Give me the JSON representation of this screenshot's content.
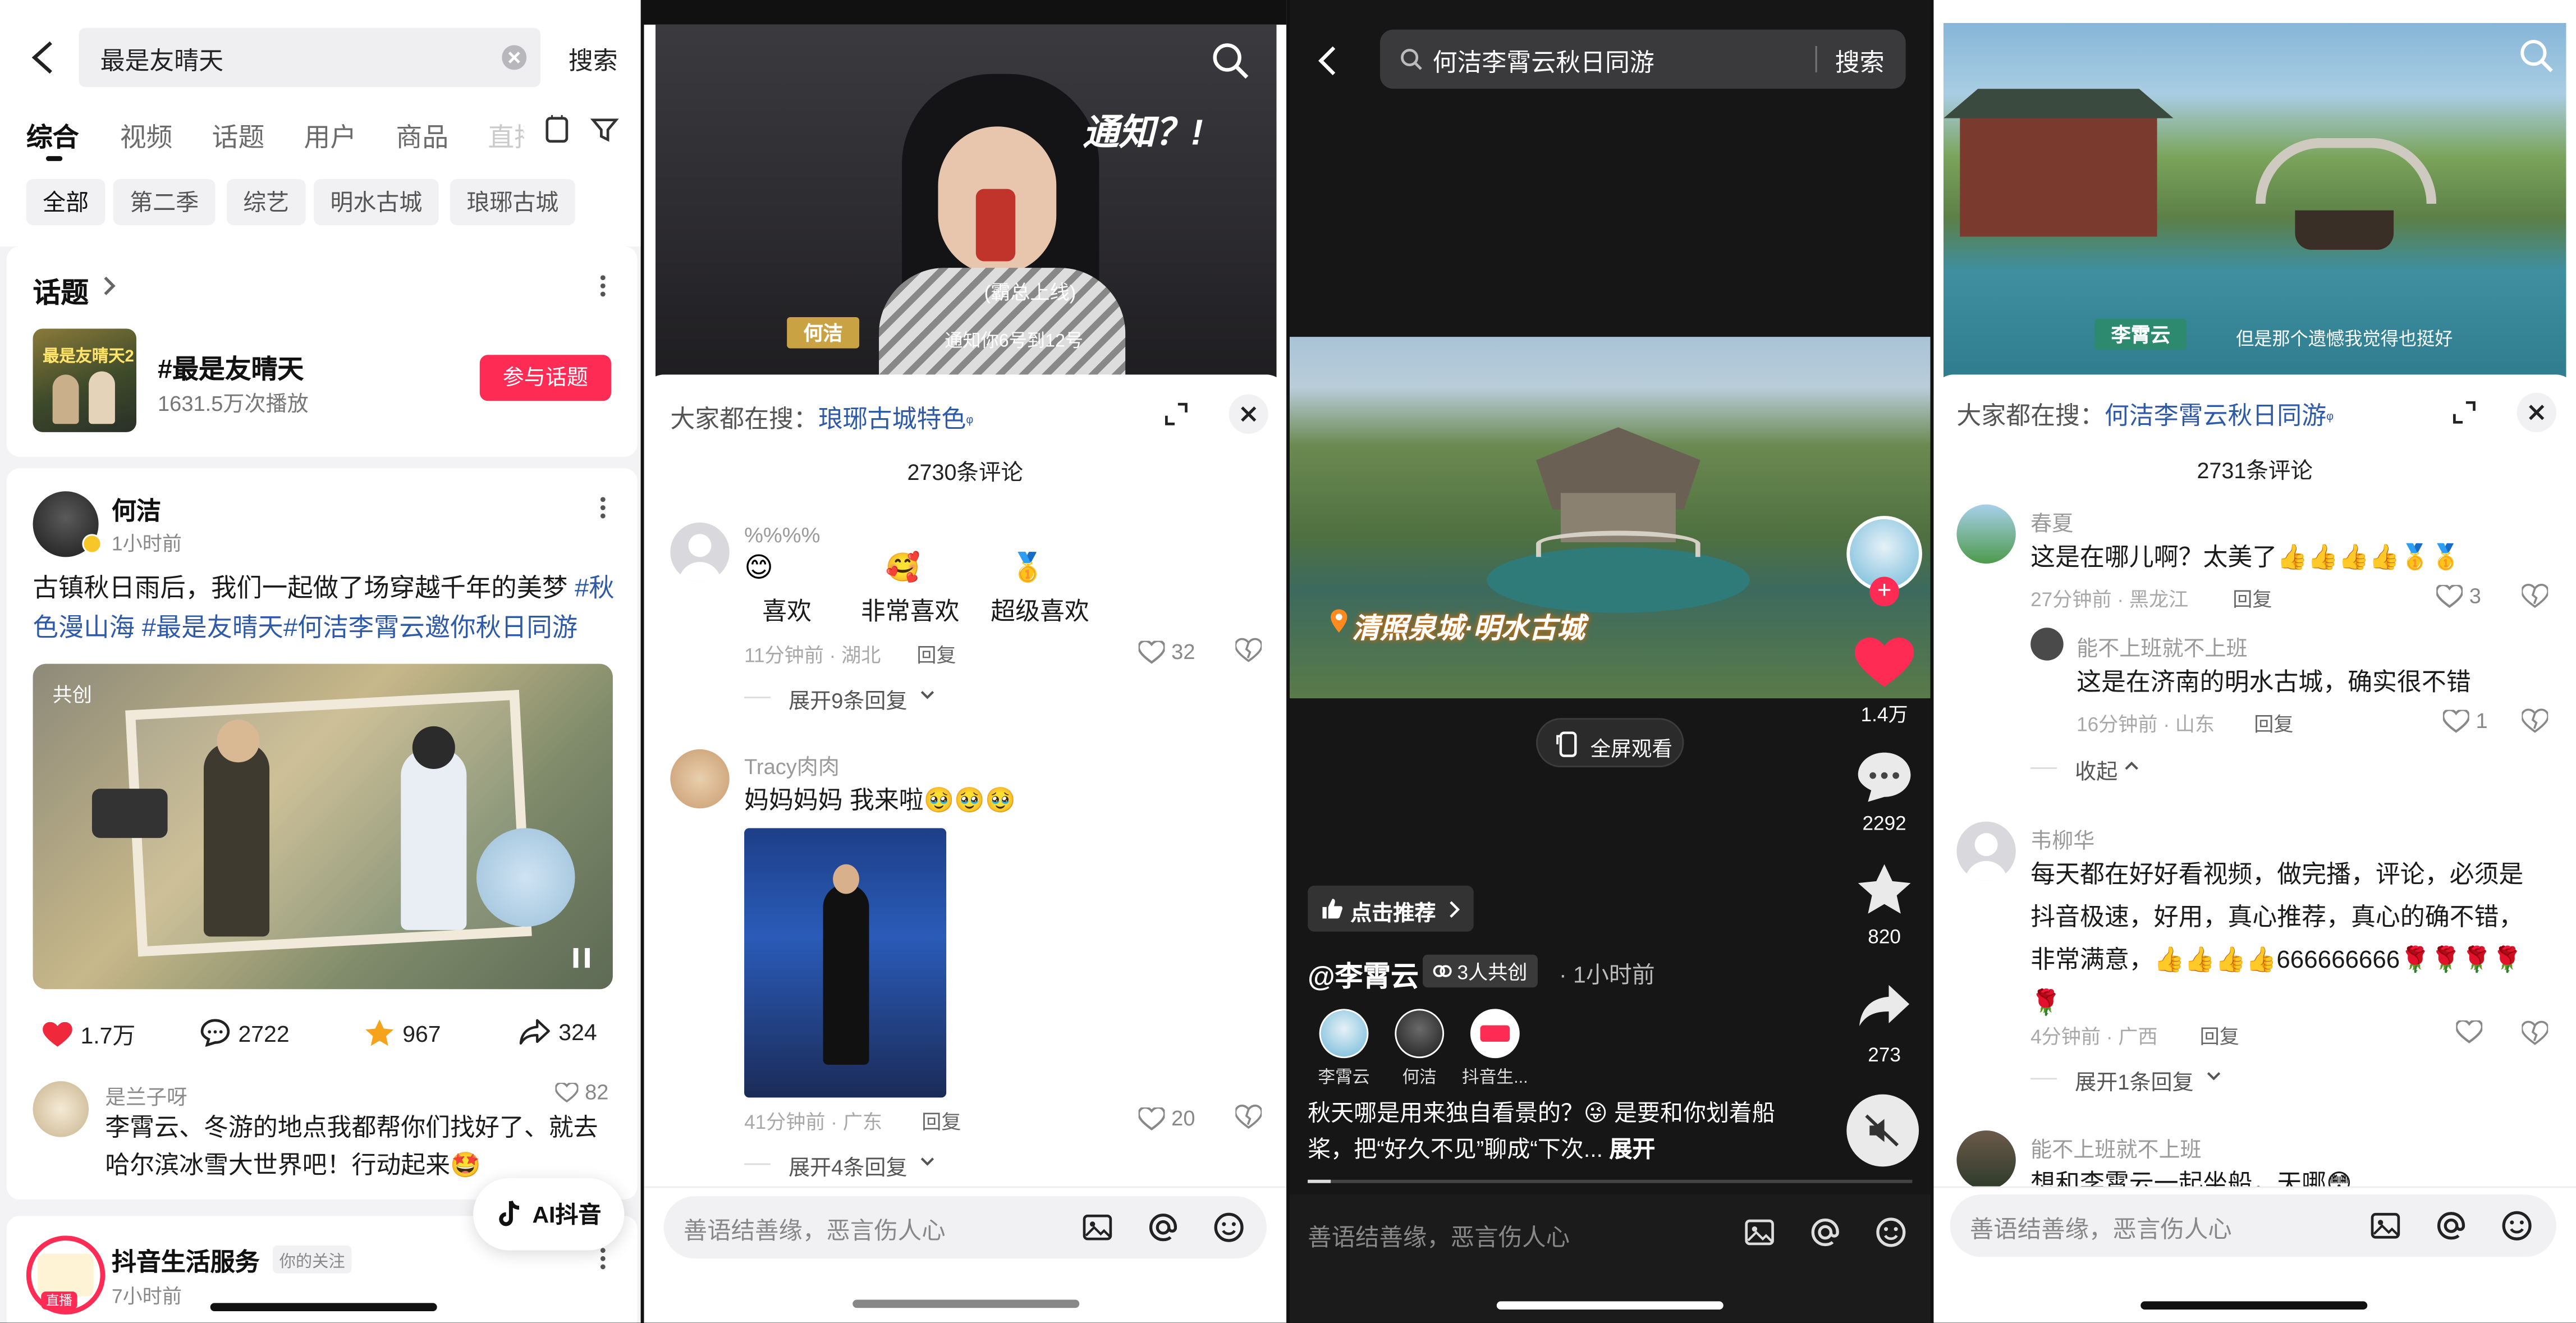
{
  "panel1": {
    "search_query": "最是友晴天",
    "search_button": "搜索",
    "tabs": [
      "综合",
      "视频",
      "话题",
      "用户",
      "商品",
      "直播"
    ],
    "chips": [
      "全部",
      "第二季",
      "综艺",
      "明水古城",
      "琅琊古城"
    ],
    "topic_section_title": "话题",
    "topic": {
      "title": "#最是友晴天",
      "plays": "1631.5万次播放",
      "join_button": "参与话题",
      "poster_text": "最是友晴天2"
    },
    "post": {
      "author": "何洁",
      "time": "1小时前",
      "text_plain": "古镇秋日雨后，我们一起做了场穿越千年的美梦 ",
      "tag1": "#秋色漫山海",
      "tag2": " #最是友晴天",
      "tag3": "#何洁李霄云邀你秋日同游",
      "image_badge": "共创",
      "likes": "1.7万",
      "comments": "2722",
      "stars": "967",
      "shares": "324",
      "top_comment": {
        "user": "是兰子呀",
        "likes": "82",
        "text": "李霄云、冬游的地点我都帮你们找好了、就去哈尔滨冰雪大世界吧！行动起来🤩"
      }
    },
    "ai_button": "AI抖音",
    "next_account": {
      "name": "抖音生活服务",
      "badge": "你的关注",
      "time": "7小时前",
      "avatar_text": "直播"
    }
  },
  "panel2": {
    "video_caption_name": "何洁",
    "video_caption_text": "通知你6号到12号",
    "video_bubble": "(霸总上线)",
    "video_big_text": "通知？!",
    "search_hint_prefix": "大家都在搜：",
    "search_hint_link": "琅琊古城特色",
    "comment_count": "2730条评论",
    "comments": [
      {
        "user": "%%%%",
        "emoji_row": [
          {
            "emoji": "😊",
            "label": "喜欢"
          },
          {
            "emoji": "🥰",
            "label": "非常喜欢"
          },
          {
            "emoji": "🥇",
            "label": "超级喜欢"
          }
        ],
        "meta": "11分钟前 · 湖北",
        "reply": "回复",
        "likes": "32",
        "expand": "展开9条回复"
      },
      {
        "user": "Tracy肉肉",
        "text": "妈妈妈妈 我来啦🥹🥹🥹",
        "meta": "41分钟前 · 广东",
        "reply": "回复",
        "likes": "20",
        "expand": "展开4条回复"
      }
    ],
    "input_placeholder": "善语结善缘，恶言伤人心"
  },
  "panel3": {
    "search_query": "何洁李霄云秋日同游",
    "search_button": "搜索",
    "location_tag": "清照泉城·明水古城",
    "fullscreen_button": "全屏观看",
    "recommend_button": "点击推荐",
    "author_handle": "@李霄云",
    "cocreate_badge": "3人共创",
    "time": "· 1小时前",
    "creators": [
      {
        "name": "李霄云"
      },
      {
        "name": "何洁"
      },
      {
        "name": "抖音生..."
      }
    ],
    "caption": "秋天哪是用来独自看景的？😜 是要和你划着船桨，把“好久不见”聊成“下次...",
    "expand": "展开",
    "likes": "1.4万",
    "comments": "2292",
    "stars": "820",
    "shares": "273",
    "input_placeholder": "善语结善缘，恶言伤人心"
  },
  "panel4": {
    "video_caption_name": "李霄云",
    "video_caption_text": "但是那个遗憾我觉得也挺好",
    "search_hint_prefix": "大家都在搜：",
    "search_hint_link": "何洁李霄云秋日同游",
    "comment_count": "2731条评论",
    "comments": [
      {
        "user": "春夏",
        "text": "这是在哪儿啊？太美了👍👍👍👍🥇🥇",
        "meta": "27分钟前 · 黑龙江",
        "reply": "回复",
        "likes": "3"
      },
      {
        "user": "能不上班就不上班",
        "text": "这是在济南的明水古城，确实很不错",
        "meta": "16分钟前 · 山东",
        "reply": "回复",
        "likes": "1",
        "collapse": "收起"
      },
      {
        "user": "韦柳华",
        "text": "每天都在好好看视频，做完播，评论，必须是抖音极速，好用，真心推荐，真心的确不错，非常满意，👍👍👍👍666666666🌹🌹🌹🌹🌹",
        "meta": "4分钟前 · 广西",
        "reply": "回复",
        "expand": "展开1条回复"
      },
      {
        "user": "能不上班就不上班",
        "text": "想和李霄云一起坐船，天哪😳"
      }
    ],
    "input_placeholder": "善语结善缘，恶言伤人心"
  },
  "colors": {
    "brand_red": "#fe2c55",
    "link_blue": "#2f5aa8",
    "heart_red": "#f0283c",
    "star_orange": "#f7a21b"
  }
}
